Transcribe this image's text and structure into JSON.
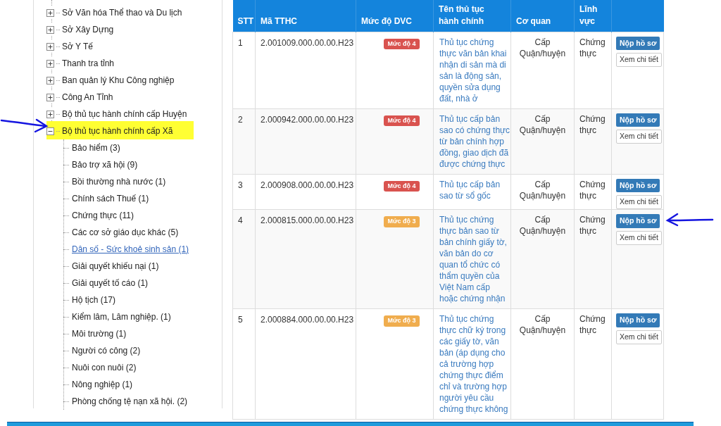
{
  "tree": {
    "items": [
      {
        "label": "Sở Văn hóa Thể thao và Du lịch",
        "expanded": false,
        "highlighted": false
      },
      {
        "label": "Sở Xây Dựng",
        "expanded": false,
        "highlighted": false
      },
      {
        "label": "Sở Y Tế",
        "expanded": false,
        "highlighted": false
      },
      {
        "label": "Thanh tra tỉnh",
        "expanded": false,
        "highlighted": false
      },
      {
        "label": "Ban quản lý Khu Công nghiệp",
        "expanded": false,
        "highlighted": false
      },
      {
        "label": "Công An Tỉnh",
        "expanded": false,
        "highlighted": false
      },
      {
        "label": "Bộ thủ tục hành chính cấp Huyện",
        "expanded": false,
        "highlighted": false
      },
      {
        "label": "Bộ thủ tục hành chính cấp Xã",
        "expanded": true,
        "highlighted": true,
        "children": [
          {
            "label": "Bảo hiểm (3)",
            "selected": false
          },
          {
            "label": "Bảo trợ xã hội (9)",
            "selected": false
          },
          {
            "label": "Bồi thường nhà nước (1)",
            "selected": false
          },
          {
            "label": "Chính sách Thuế (1)",
            "selected": false
          },
          {
            "label": "Chứng thực (11)",
            "selected": false
          },
          {
            "label": "Các cơ sở giáo dục khác (5)",
            "selected": false
          },
          {
            "label": "Dân số - Sức khoẻ sinh sản (1)",
            "selected": true
          },
          {
            "label": "Giải quyết khiếu nại (1)",
            "selected": false
          },
          {
            "label": "Giải quyết tố cáo (1)",
            "selected": false
          },
          {
            "label": "Hộ tịch (17)",
            "selected": false
          },
          {
            "label": "Kiểm lâm, Lâm nghiệp. (1)",
            "selected": false
          },
          {
            "label": "Môi trường (1)",
            "selected": false
          },
          {
            "label": "Người có công (2)",
            "selected": false
          },
          {
            "label": "Nuôi con nuôi (2)",
            "selected": false
          },
          {
            "label": "Nông nghiệp (1)",
            "selected": false
          },
          {
            "label": "Phòng chống tệ nạn xã hội. (2)",
            "selected": false
          }
        ]
      }
    ]
  },
  "table": {
    "columns": [
      "STT",
      "Mã TTHC",
      "Mức độ DVC",
      "Tên thủ tục hành chính",
      "Cơ quan",
      "Lĩnh vực"
    ],
    "rows": [
      {
        "stt": "1",
        "code": "2.001009.000.00.00.H23",
        "badge": {
          "text": "Mức độ 4",
          "color": "#d9534f"
        },
        "name": "Thủ tục chứng thực văn bản khai nhận di sản mà di sản là động sản, quyền sửa dụng đất, nhà ở",
        "agency": "Cấp Quận/huyện",
        "field": "Chứng thực",
        "submit": "Nộp hồ sơ",
        "details": "Xem chi tiết"
      },
      {
        "stt": "2",
        "code": "2.000942.000.00.00.H23",
        "badge": {
          "text": "Mức độ 4",
          "color": "#d9534f"
        },
        "name": "Thủ tục cấp bản sao có chứng thực từ bản chính hợp đồng, giao dịch đã được chứng thực",
        "agency": "Cấp Quận/huyện",
        "field": "Chứng thực",
        "submit": "Nộp hồ sơ",
        "details": "Xem chi tiết"
      },
      {
        "stt": "3",
        "code": "2.000908.000.00.00.H23",
        "badge": {
          "text": "Mức độ 4",
          "color": "#d9534f"
        },
        "name": "Thủ tục cấp bản sao từ sổ gốc",
        "agency": "Cấp Quận/huyện",
        "field": "Chứng thực",
        "submit": "Nộp hồ sơ",
        "details": "Xem chi tiết"
      },
      {
        "stt": "4",
        "code": "2.000815.000.00.00.H23",
        "badge": {
          "text": "Mức độ 3",
          "color": "#f0ad4e"
        },
        "name": "Thủ tục chứng thực bản sao từ bản chính giấy tờ, văn bản do cơ quan tổ chức có thẩm quyền của Việt Nam cấp hoặc chứng nhận",
        "agency": "Cấp Quận/huyện",
        "field": "Chứng thực",
        "submit": "Nộp hồ sơ",
        "details": "Xem chi tiết"
      },
      {
        "stt": "5",
        "code": "2.000884.000.00.00.H23",
        "badge": {
          "text": "Mức độ 3",
          "color": "#f0ad4e"
        },
        "name": "Thủ tục chứng thực chữ ký trong các giấy tờ, văn bản (áp dụng cho cả trường hợp chứng thực điểm chỉ và trường hợp người yêu cầu chứng thực không",
        "agency": "Cấp Quận/huyện",
        "field": "Chứng thực",
        "submit": "Nộp hồ sơ",
        "details": "Xem chi tiết"
      }
    ]
  }
}
